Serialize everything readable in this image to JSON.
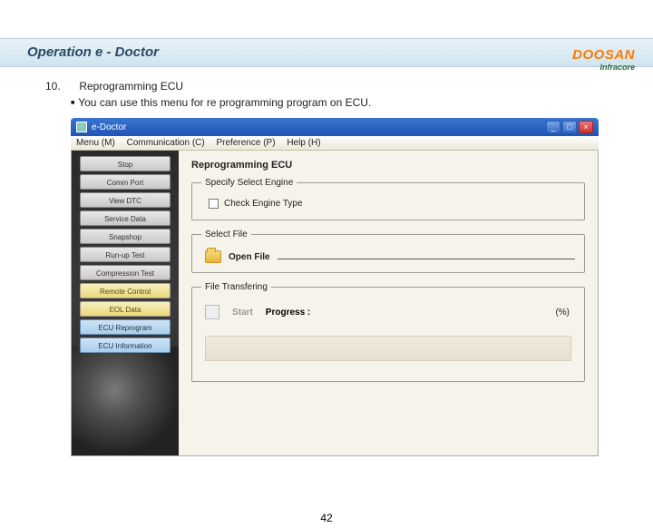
{
  "logo": {
    "brand": "DOOSAN",
    "sub": "Infracore"
  },
  "title": "Operation e - Doctor",
  "section": {
    "num": "10.",
    "heading": "Reprogramming ECU"
  },
  "bullet": "You can use this menu for re programming program on ECU.",
  "window": {
    "title": "e-Doctor",
    "menus": {
      "m1": "Menu (M)",
      "m2": "Communication (C)",
      "m3": "Preference (P)",
      "m4": "Help (H)"
    },
    "ctrls": {
      "min": "_",
      "max": "□",
      "close": "×"
    }
  },
  "sidebar": {
    "b0": "Stop",
    "b1": "Comm Port",
    "b2": "View DTC",
    "b3": "Service Data",
    "b4": "Snapshop",
    "b5": "Run-up Test",
    "b6": "Compression Test",
    "b7": "Remote Control",
    "b8": "EOL Data",
    "b9": "ECU Reprogram",
    "b10": "ECU Information"
  },
  "panel": {
    "title": "Reprogramming ECU",
    "grp1": "Specify Select Engine",
    "chk": "Check Engine Type",
    "grp2": "Select File",
    "open": "Open File",
    "grp3": "File Transfering",
    "start": "Start",
    "progress": "Progress :",
    "pct": "(%)"
  },
  "page": "42"
}
